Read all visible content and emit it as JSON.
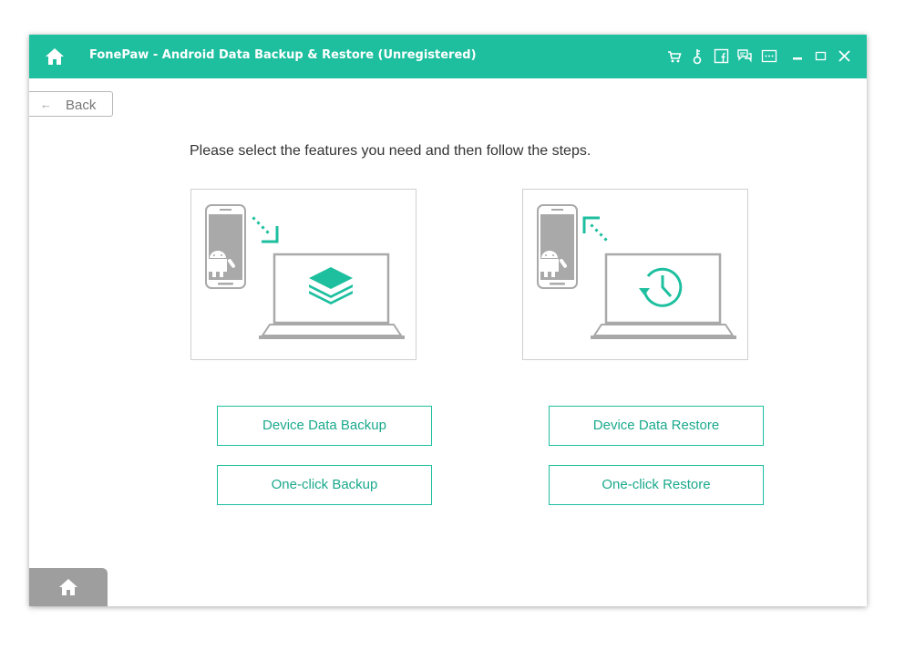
{
  "titlebar": {
    "title": "FonePaw - Android Data Backup & Restore (Unregistered)",
    "icons": [
      "home-icon",
      "cart-icon",
      "key-icon",
      "facebook-icon",
      "feedback-icon",
      "menu-icon",
      "minimize-icon",
      "maximize-icon",
      "close-icon"
    ]
  },
  "nav": {
    "back_label": "Back",
    "back_arrow": "←"
  },
  "main": {
    "instruction": "Please select the features you need and then follow the steps."
  },
  "backup": {
    "primary_button": "Device Data Backup",
    "secondary_button": "One-click Backup"
  },
  "restore": {
    "primary_button": "Device Data Restore",
    "secondary_button": "One-click Restore"
  },
  "colors": {
    "accent": "#1dbf9f",
    "accent_text": "#1aa98c",
    "illustration_gray": "#a9a9a9",
    "bottom_bar": "#9e9e9e"
  }
}
